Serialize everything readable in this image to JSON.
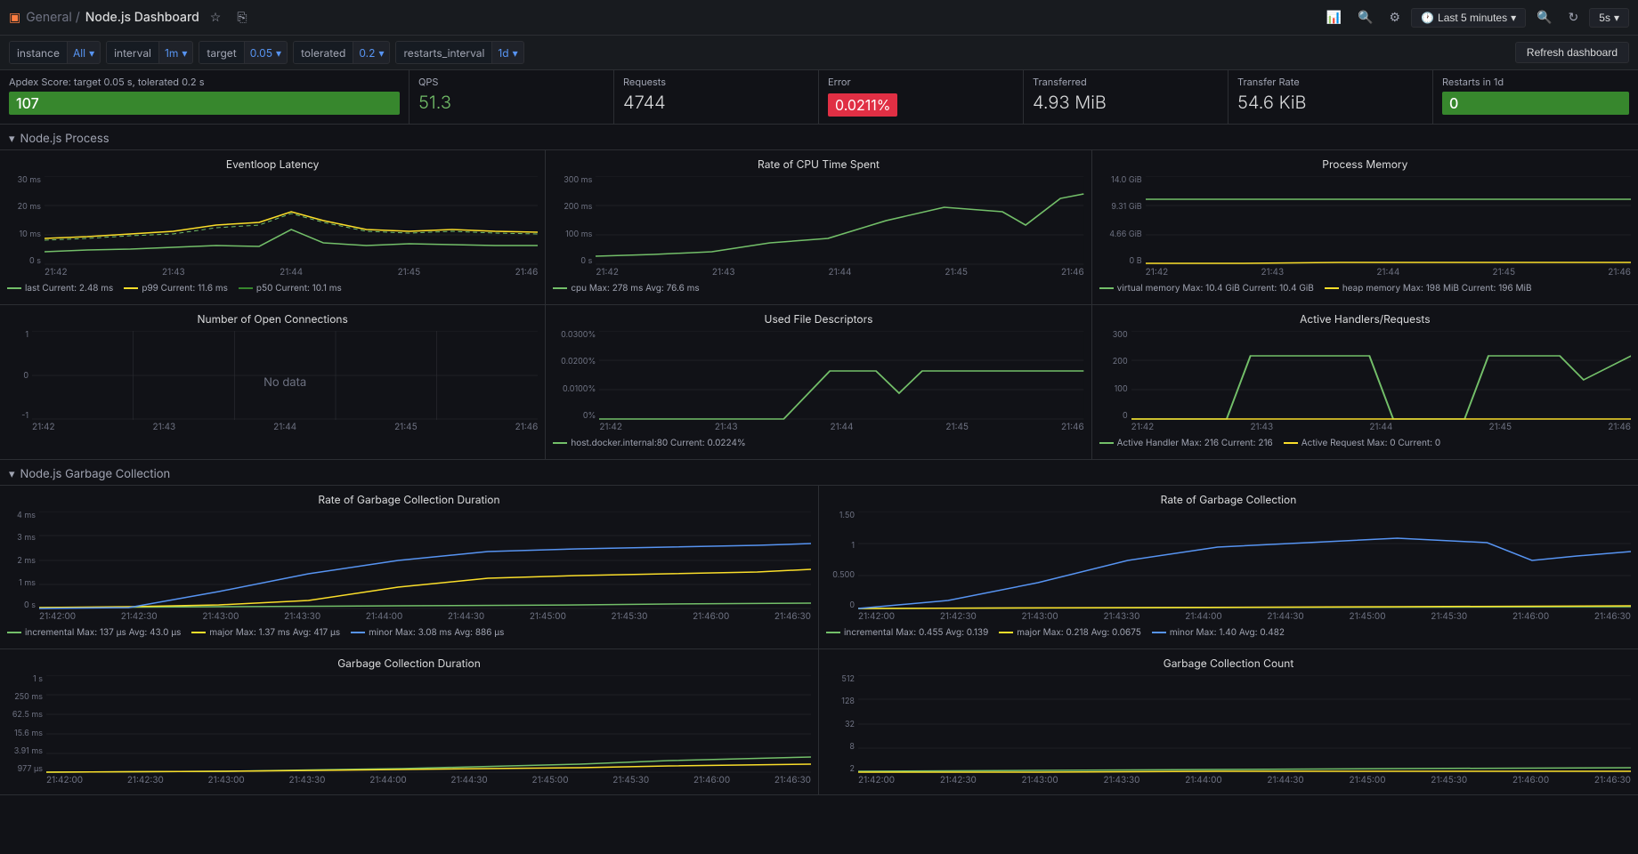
{
  "header": {
    "logo": "▣",
    "breadcrumb": "General /",
    "title": "Node.js Dashboard",
    "timeRange": "Last 5 minutes",
    "refreshInterval": "5s",
    "refreshLabel": "Refresh dashboard"
  },
  "filters": [
    {
      "key": "instance",
      "label": "instance",
      "value": "All"
    },
    {
      "key": "interval",
      "label": "interval",
      "value": "1m"
    },
    {
      "key": "target",
      "label": "target",
      "value": "0.05"
    },
    {
      "key": "tolerated",
      "label": "tolerated",
      "value": "0.2"
    },
    {
      "key": "restarts_interval",
      "label": "restarts_interval",
      "value": "1d"
    }
  ],
  "stats": [
    {
      "id": "apdex",
      "title": "Apdex Score: target 0.05 s, tolerated 0.2 s",
      "value": "107",
      "type": "bar-green"
    },
    {
      "id": "qps",
      "title": "QPS",
      "value": "51.3",
      "type": "plain-green"
    },
    {
      "id": "requests",
      "title": "Requests",
      "value": "4744",
      "type": "plain"
    },
    {
      "id": "error",
      "title": "Error",
      "value": "0.0211%",
      "type": "bar-red"
    },
    {
      "id": "transferred",
      "title": "Transferred",
      "value": "4.93 MiB",
      "type": "plain"
    },
    {
      "id": "transfer_rate",
      "title": "Transfer Rate",
      "value": "54.6 KiB",
      "type": "plain"
    },
    {
      "id": "restarts",
      "title": "Restarts in 1d",
      "value": "0",
      "type": "bar-green"
    }
  ],
  "sections": [
    {
      "id": "nodejs-process",
      "label": "Node.js Process",
      "collapsed": false
    },
    {
      "id": "nodejs-gc",
      "label": "Node.js Garbage Collection",
      "collapsed": false
    }
  ],
  "charts": {
    "process": [
      {
        "id": "eventloop-latency",
        "title": "Eventloop Latency",
        "yLabels": [
          "30 ms",
          "20 ms",
          "10 ms",
          "0 s"
        ],
        "xLabels": [
          "21:42",
          "21:43",
          "21:44",
          "21:45",
          "21:46"
        ],
        "legend": [
          {
            "color": "green",
            "label": "last",
            "current": "Current: 2.48 ms"
          },
          {
            "color": "yellow",
            "label": "p99",
            "current": "Current: 11.6 ms"
          },
          {
            "color": "green",
            "label": "p50",
            "current": "Current: 10.1 ms"
          }
        ]
      },
      {
        "id": "cpu-time",
        "title": "Rate of CPU Time Spent",
        "yLabels": [
          "300 ms",
          "200 ms",
          "100 ms",
          "0 s"
        ],
        "xLabels": [
          "21:42",
          "21:43",
          "21:44",
          "21:45",
          "21:46"
        ],
        "legend": [
          {
            "color": "green",
            "label": "cpu",
            "extra": "Max: 278 ms  Avg: 76.6 ms"
          }
        ]
      },
      {
        "id": "process-memory",
        "title": "Process Memory",
        "yLabels": [
          "14.0 GiB",
          "9.31 GiB",
          "4.66 GiB",
          "0 B"
        ],
        "xLabels": [
          "21:42",
          "21:43",
          "21:44",
          "21:45",
          "21:46"
        ],
        "legend": [
          {
            "color": "green",
            "label": "virtual memory",
            "extra": "Max: 10.4 GiB  Current: 10.4 GiB"
          },
          {
            "color": "yellow",
            "label": "heap memory",
            "extra": "Max: 198 MiB  Current: 196 MiB"
          }
        ]
      },
      {
        "id": "open-connections",
        "title": "Number of Open Connections",
        "yLabels": [
          "1",
          "0",
          "-1"
        ],
        "xLabels": [
          "21:42",
          "21:43",
          "21:44",
          "21:45",
          "21:46"
        ],
        "noData": true
      },
      {
        "id": "file-descriptors",
        "title": "Used File Descriptors",
        "yLabels": [
          "0.0300%",
          "0.0200%",
          "0.0100%",
          "0%"
        ],
        "xLabels": [
          "21:42",
          "21:43",
          "21:44",
          "21:45",
          "21:46"
        ],
        "legend": [
          {
            "color": "green",
            "label": "host.docker.internal:80",
            "extra": "Current: 0.0224%"
          }
        ]
      },
      {
        "id": "active-handlers",
        "title": "Active Handlers/Requests",
        "yLabels": [
          "300",
          "200",
          "100",
          "0"
        ],
        "xLabels": [
          "21:42",
          "21:43",
          "21:44",
          "21:45",
          "21:46"
        ],
        "legend": [
          {
            "color": "green",
            "label": "Active Handler",
            "extra": "Max: 216  Current: 216"
          },
          {
            "color": "yellow",
            "label": "Active Request",
            "extra": "Max: 0  Current: 0"
          }
        ]
      }
    ],
    "gc": [
      {
        "id": "gc-duration-rate",
        "title": "Rate of Garbage Collection Duration",
        "yLabels": [
          "4 ms",
          "3 ms",
          "2 ms",
          "1 ms",
          "0 s"
        ],
        "xLabels": [
          "21:42:00",
          "21:42:30",
          "21:43:00",
          "21:43:30",
          "21:44:00",
          "21:44:30",
          "21:45:00",
          "21:45:30",
          "21:46:00",
          "21:46:30"
        ],
        "legend": [
          {
            "color": "green",
            "label": "incremental",
            "extra": "Max: 137 µs  Avg: 43.0 µs"
          },
          {
            "color": "yellow",
            "label": "major",
            "extra": "Max: 1.37 ms  Avg: 417 µs"
          },
          {
            "color": "cyan",
            "label": "minor",
            "extra": "Max: 3.08 ms  Avg: 886 µs"
          }
        ]
      },
      {
        "id": "gc-rate",
        "title": "Rate of Garbage Collection",
        "yLabels": [
          "1.50",
          "1",
          "0.500",
          "0"
        ],
        "xLabels": [
          "21:42:00",
          "21:42:30",
          "21:43:00",
          "21:43:30",
          "21:44:00",
          "21:44:30",
          "21:45:00",
          "21:45:30",
          "21:46:00",
          "21:46:30"
        ],
        "legend": [
          {
            "color": "green",
            "label": "incremental",
            "extra": "Max: 0.455  Avg: 0.139"
          },
          {
            "color": "yellow",
            "label": "major",
            "extra": "Max: 0.218  Avg: 0.0675"
          },
          {
            "color": "cyan",
            "label": "minor",
            "extra": "Max: 1.40  Avg: 0.482"
          }
        ]
      },
      {
        "id": "gc-duration",
        "title": "Garbage Collection Duration",
        "yLabels": [
          "1 s",
          "250 ms",
          "62.5 ms",
          "15.6 ms",
          "3.91 ms",
          "977 µs"
        ],
        "xLabels": [
          "21:42:00",
          "21:42:30",
          "21:43:00",
          "21:43:30",
          "21:44:00",
          "21:44:30",
          "21:45:00",
          "21:45:30",
          "21:46:00",
          "21:46:30"
        ],
        "legend": []
      },
      {
        "id": "gc-count",
        "title": "Garbage Collection Count",
        "yLabels": [
          "512",
          "128",
          "32",
          "8",
          "2"
        ],
        "xLabels": [
          "21:42:00",
          "21:42:30",
          "21:43:00",
          "21:43:30",
          "21:44:00",
          "21:44:30",
          "21:45:00",
          "21:45:30",
          "21:46:00",
          "21:46:30"
        ],
        "legend": []
      }
    ]
  }
}
